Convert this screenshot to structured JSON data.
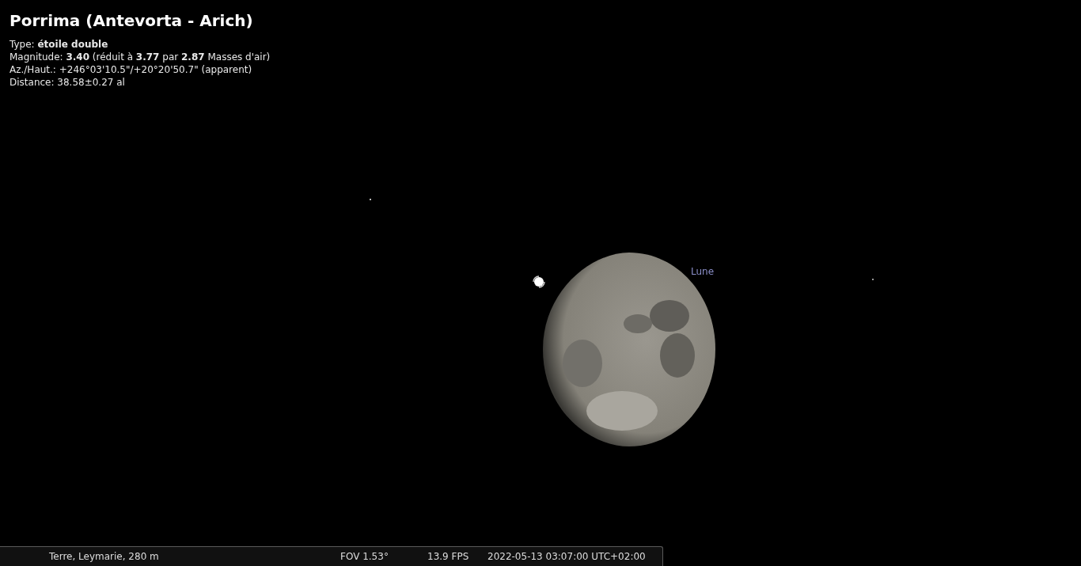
{
  "object_info": {
    "title": "Porrima (Antevorta - Arich)",
    "lines": [
      "Type: **étoile double**",
      "Magnitude: **3.40** (réduit à **3.77** par **2.87** Masses d'air)",
      "Az./Haut.: +246°03'10.5\"/+20°20'50.7\" (apparent)",
      "Distance: 38.58±0.27 al"
    ]
  },
  "sky": {
    "moon_label": "Lune"
  },
  "status_bar": {
    "location": "Terre, Leymarie, 280 m",
    "fov": "FOV 1.53°",
    "fps": "13.9 FPS",
    "datetime": "2022-05-13 03:07:00 UTC+02:00"
  }
}
